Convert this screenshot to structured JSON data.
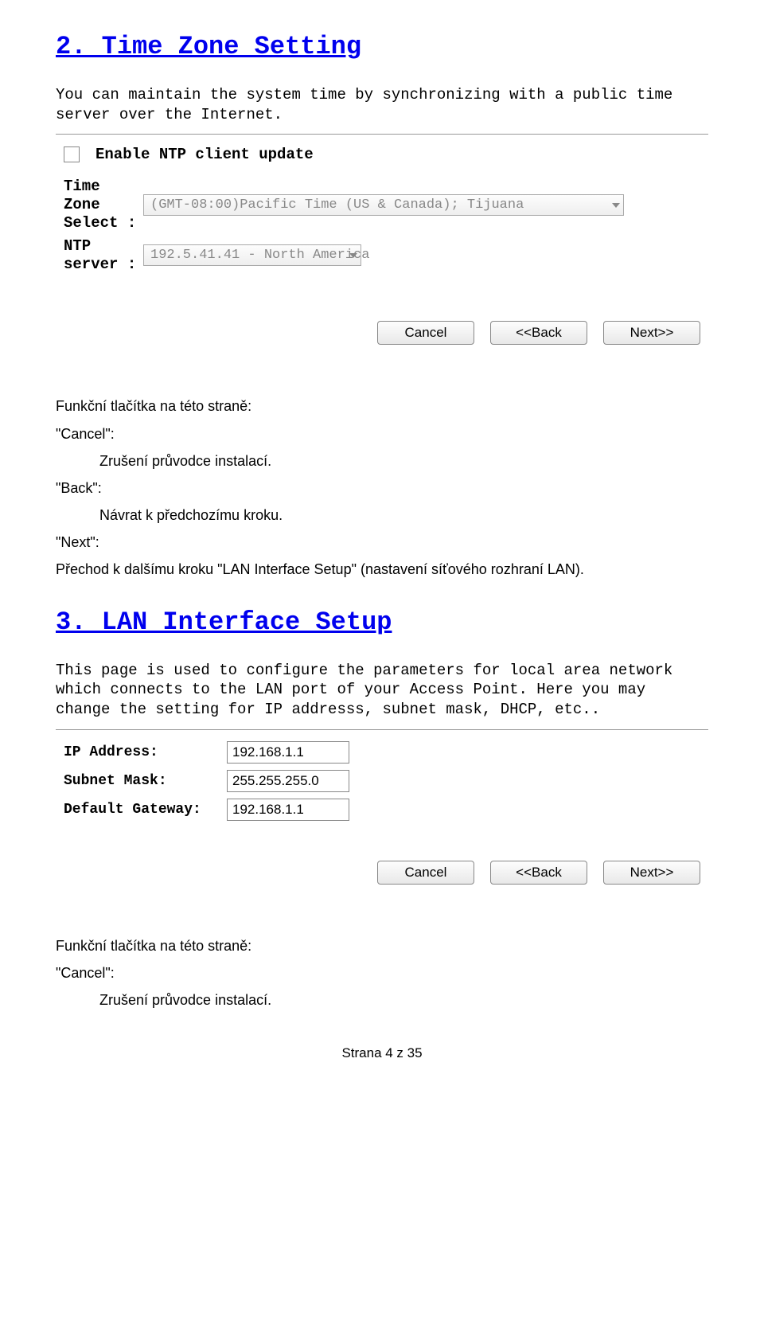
{
  "section2": {
    "title": "2. Time Zone Setting",
    "desc": "You can maintain the system time by synchronizing with a public time server over the Internet.",
    "checkbox_label": "Enable NTP client update",
    "tz_label": "Time Zone Select :",
    "tz_value": "(GMT-08:00)Pacific Time (US & Canada); Tijuana",
    "ntp_label": "NTP server :",
    "ntp_value": "192.5.41.41 - North America"
  },
  "buttons": {
    "cancel": "Cancel",
    "back": "<<Back",
    "next": "Next>>"
  },
  "czech1": {
    "l1": "Funkční tlačítka na této straně:",
    "l2": "\"Cancel\":",
    "l3": "Zrušení průvodce instalací.",
    "l4": "\"Back\":",
    "l5": "Návrat k předchozímu kroku.",
    "l6": "\"Next\":",
    "l7": "Přechod k dalšímu kroku \"LAN Interface Setup\" (nastavení síťového rozhraní LAN)."
  },
  "section3": {
    "title": "3. LAN Interface Setup",
    "desc": "This page is used to configure the parameters for local area network which connects to the LAN port of your Access Point. Here you may change the setting for IP addresss, subnet mask, DHCP, etc..",
    "ip_label": "IP Address:",
    "ip_value": "192.168.1.1",
    "mask_label": "Subnet Mask:",
    "mask_value": "255.255.255.0",
    "gw_label": "Default Gateway:",
    "gw_value": "192.168.1.1"
  },
  "czech2": {
    "l1": "Funkční tlačítka na této straně:",
    "l2": "\"Cancel\":",
    "l3": "Zrušení průvodce instalací."
  },
  "footer": "Strana 4 z 35"
}
